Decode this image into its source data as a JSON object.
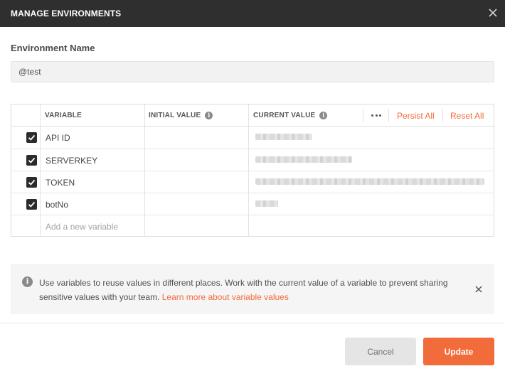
{
  "dialog": {
    "title": "MANAGE ENVIRONMENTS"
  },
  "environment": {
    "label": "Environment Name",
    "name_value": "@test"
  },
  "table": {
    "headers": {
      "variable": "VARIABLE",
      "initial_value": "INITIAL VALUE",
      "current_value": "CURRENT VALUE"
    },
    "actions": {
      "persist_all": "Persist All",
      "reset_all": "Reset All"
    },
    "rows": [
      {
        "checked": true,
        "variable": "API ID"
      },
      {
        "checked": true,
        "variable": "SERVERKEY"
      },
      {
        "checked": true,
        "variable": "TOKEN"
      },
      {
        "checked": true,
        "variable": "botNo"
      }
    ],
    "new_variable_placeholder": "Add a new variable"
  },
  "info": {
    "message": "Use variables to reuse values in different places. Work with the current value of a variable to prevent sharing sensitive values with your team.",
    "link": "Learn more about variable values"
  },
  "footer": {
    "cancel_label": "Cancel",
    "update_label": "Update"
  },
  "colors": {
    "accent": "#f26b3a",
    "titlebar": "#2f2f2f"
  }
}
